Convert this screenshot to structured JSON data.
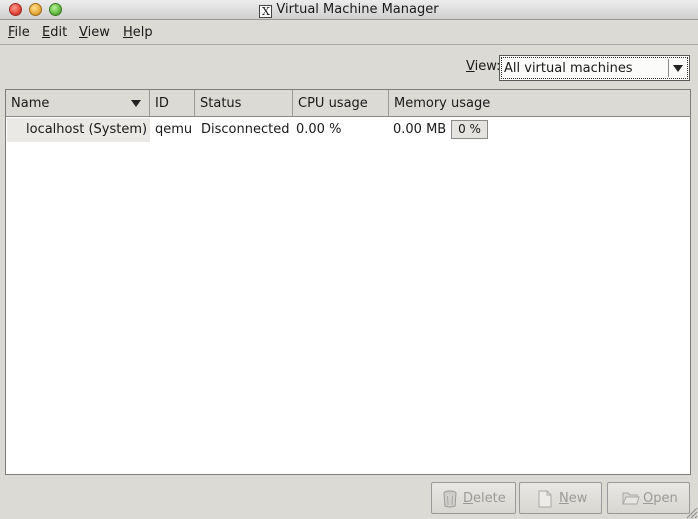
{
  "window": {
    "title": "Virtual Machine Manager"
  },
  "menu": {
    "items": [
      "File",
      "Edit",
      "View",
      "Help"
    ]
  },
  "view_filter": {
    "label": "View:",
    "selected": "All virtual machines"
  },
  "table": {
    "columns": [
      "Name",
      "ID",
      "Status",
      "CPU usage",
      "Memory usage"
    ],
    "rows": [
      {
        "name": "localhost (System)",
        "id": "qemu",
        "status": "Disconnected",
        "cpu": "0.00 %",
        "memory": "0.00 MB",
        "memory_percent": "0 %"
      }
    ]
  },
  "buttons": {
    "delete": "Delete",
    "new": "New",
    "open": "Open"
  },
  "icons": {
    "delete": "trash-can-icon",
    "new": "new-document-icon",
    "open": "folder-open-icon"
  }
}
